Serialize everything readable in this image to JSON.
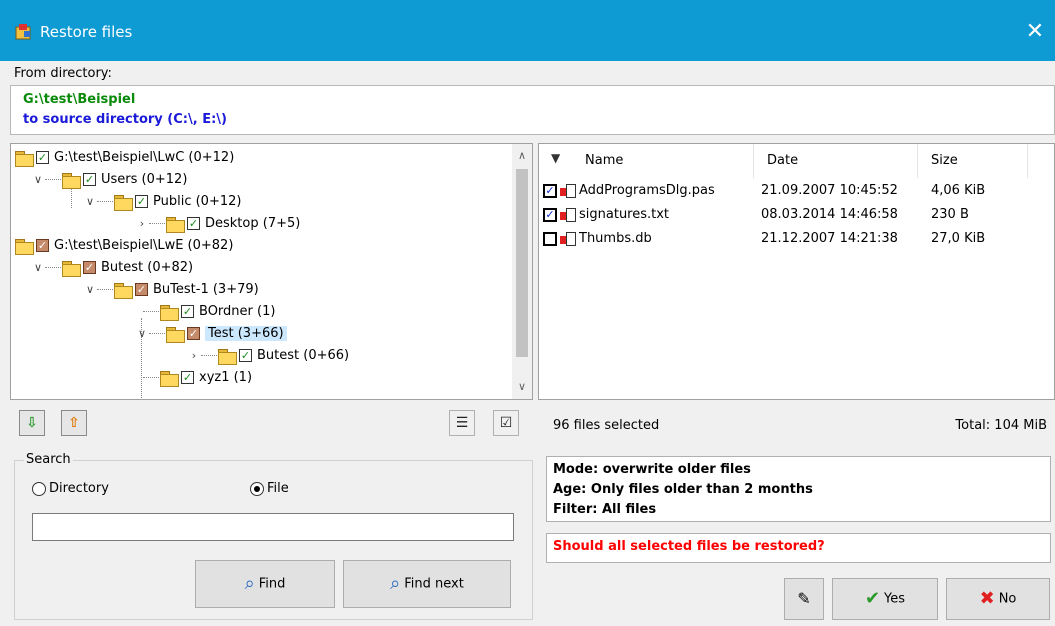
{
  "window": {
    "title": "Restore files",
    "close_glyph": "✕",
    "app_icon": "restore-app-icon"
  },
  "from": {
    "label": "From directory:",
    "path": "G:\\test\\Beispiel",
    "target": "to source directory (C:\\, E:\\)"
  },
  "tree": {
    "items": [
      {
        "label": "G:\\test\\Beispiel\\LwC (0+12)"
      },
      {
        "label": "Users (0+12)"
      },
      {
        "label": "Public (0+12)"
      },
      {
        "label": "Desktop (7+5)"
      },
      {
        "label": "G:\\test\\Beispiel\\LwE (0+82)"
      },
      {
        "label": "Butest (0+82)"
      },
      {
        "label": "BuTest-1 (3+79)"
      },
      {
        "label": "BOrdner (1)"
      },
      {
        "label": "Test (3+66)"
      },
      {
        "label": "Butest (0+66)"
      },
      {
        "label": "xyz1 (1)"
      }
    ]
  },
  "files": {
    "columns": {
      "name": "Name",
      "date": "Date",
      "size": "Size"
    },
    "rows": [
      {
        "name": "AddProgramsDlg.pas",
        "date": "21.09.2007 10:45:52",
        "size": "4,06 KiB",
        "checked": true
      },
      {
        "name": "signatures.txt",
        "date": "08.03.2014 14:46:58",
        "size": "230 B",
        "checked": true
      },
      {
        "name": "Thumbs.db",
        "date": "21.12.2007 14:21:38",
        "size": "27,0 KiB",
        "checked": false
      }
    ]
  },
  "status": {
    "selected": "96 files selected",
    "total": "Total: 104 MiB"
  },
  "search": {
    "legend": "Search",
    "option_directory": "Directory",
    "option_file": "File",
    "selected_option": "File",
    "query": "",
    "find_label": "Find",
    "find_next_label": "Find next"
  },
  "info": {
    "mode": "Mode: overwrite older files",
    "age": "Age: Only files older than 2 months",
    "filter": "Filter: All files"
  },
  "question": "Should all selected files be restored?",
  "actions": {
    "yes_label": "Yes",
    "no_label": "No"
  }
}
